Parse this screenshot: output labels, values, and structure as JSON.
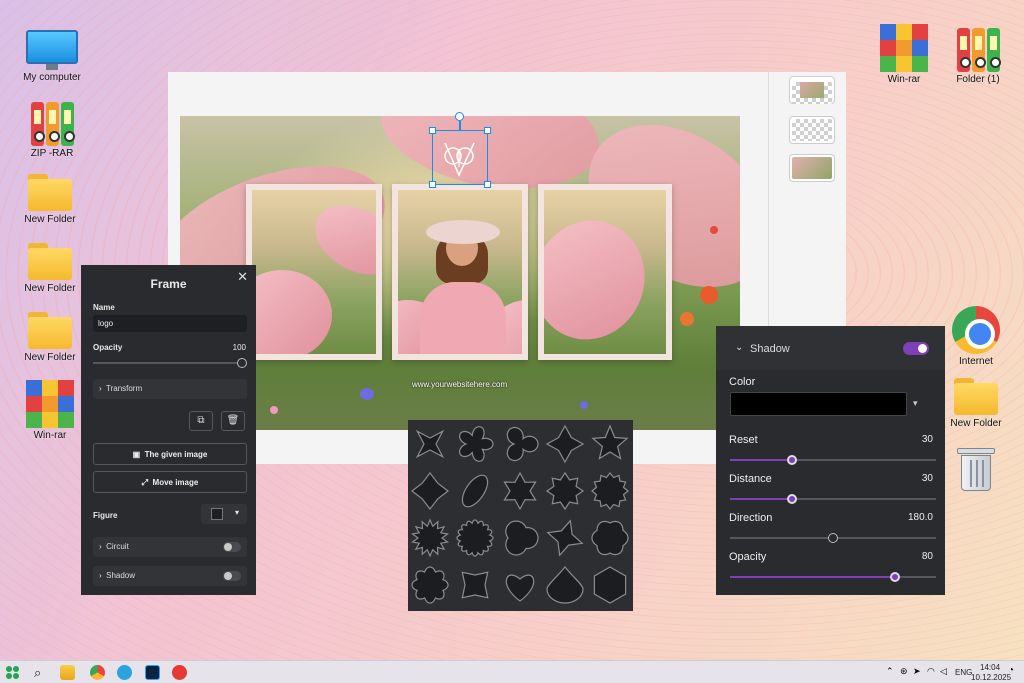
{
  "desktop": {
    "left_icons": [
      {
        "label": "My computer",
        "icon": "monitor-icon"
      },
      {
        "label": "ZIP -RAR",
        "icon": "binders-icon"
      },
      {
        "label": "New Folder",
        "icon": "folder-icon"
      },
      {
        "label": "New Folder",
        "icon": "folder-icon"
      },
      {
        "label": "New Folder",
        "icon": "folder-icon"
      },
      {
        "label": "Win-rar",
        "icon": "winrar-icon"
      }
    ],
    "right_icons": [
      {
        "label": "Win-rar",
        "icon": "winrar-icon"
      },
      {
        "label": "Folder (1)",
        "icon": "binders-icon"
      },
      {
        "label": "Internet",
        "icon": "chrome-icon"
      },
      {
        "label": "New Folder",
        "icon": "folder-icon"
      },
      {
        "label": "",
        "icon": "trash-icon"
      }
    ]
  },
  "editor": {
    "watermark": "www.yourwebsitehere.com",
    "thumbnails": [
      "photo-thumb",
      "transparent-thumb",
      "photo-thumb"
    ]
  },
  "frame_panel": {
    "title": "Frame",
    "name_label": "Name",
    "name_value": "logo",
    "opacity_label": "Opacity",
    "opacity_value": "100",
    "transform_label": "Transform",
    "given_image_label": "The given image",
    "move_image_label": "Move image",
    "figure_label": "Figure",
    "circuit_label": "Circuit",
    "shadow_label": "Shadow"
  },
  "shapes_panel": {
    "shapes": [
      "star-4",
      "flower-5",
      "tri-lobe",
      "cross-star",
      "star-5",
      "diamond",
      "ellipse-tilt",
      "star-6",
      "star-8",
      "seal-12",
      "burst",
      "scallop",
      "swirl",
      "pinwheel",
      "blob",
      "cog-blob",
      "cross-x",
      "heart",
      "drop",
      "hexagon"
    ]
  },
  "shadow_panel": {
    "title": "Shadow",
    "enabled": true,
    "accent_color": "#7e3fb8",
    "color_label": "Color",
    "color_value": "#000000",
    "reset_label": "Reset",
    "reset_value": "30",
    "reset_fraction": 0.3,
    "distance_label": "Distance",
    "distance_value": "30",
    "distance_fraction": 0.3,
    "direction_label": "Direction",
    "direction_value": "180.0",
    "direction_fraction": 0.5,
    "opacity_label": "Opacity",
    "opacity_value": "80",
    "opacity_fraction": 0.8
  },
  "taskbar": {
    "language": "ENG",
    "time": "14:04",
    "date": "10.12.2025"
  }
}
